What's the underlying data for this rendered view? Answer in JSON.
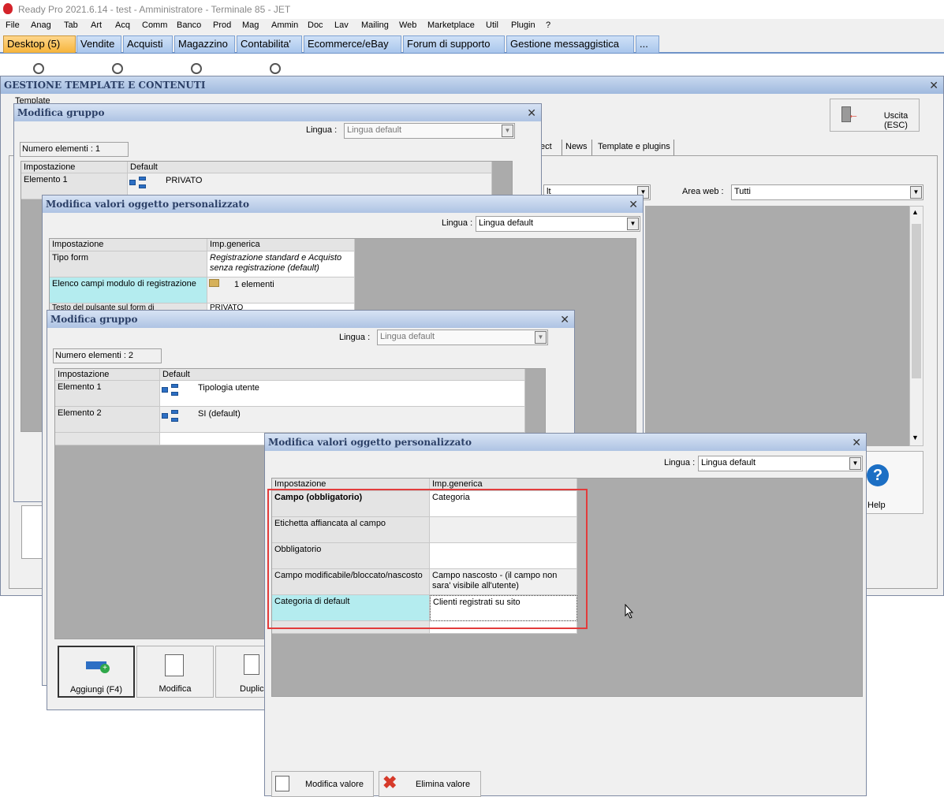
{
  "app": {
    "title": "Ready Pro 2021.6.14 - test - Amministratore - Terminale 85 - JET"
  },
  "menu": [
    "File",
    "Anag",
    "Tab",
    "Art",
    "Acq",
    "Comm",
    "Banco",
    "Prod",
    "Mag",
    "Ammin",
    "Doc",
    "Lav",
    "Mailing",
    "Web",
    "Marketplace",
    "Util",
    "Plugin",
    "?"
  ],
  "tabs": [
    "Desktop (5)",
    "Vendite",
    "Acquisti",
    "Magazzino",
    "Contabilita'",
    "Ecommerce/eBay",
    "Forum di supporto",
    "Gestione messaggistica",
    "..."
  ],
  "main_window": {
    "title": "GESTIONE TEMPLATE E CONTENUTI",
    "template_label": "Template",
    "exit_button": "Uscita (ESC)",
    "tabs": [
      "ect",
      "News",
      "Template e plugins"
    ],
    "area_web_label": "Area web :",
    "area_web_value": "Tutti",
    "left_combo_fragment": "lt",
    "help_label": "Help",
    "left_fragment": "A"
  },
  "win1": {
    "title": "Modifica gruppo",
    "lingua_label": "Lingua :",
    "lingua_value": "Lingua default",
    "count": "Numero elementi : 1",
    "headers": [
      "Impostazione",
      "Default"
    ],
    "rows": [
      {
        "key": "Elemento 1",
        "value": "PRIVATO"
      }
    ]
  },
  "win2": {
    "title": "Modifica valori oggetto personalizzato",
    "lingua_label": "Lingua :",
    "lingua_value": "Lingua default",
    "headers": [
      "Impostazione",
      "Imp.generica"
    ],
    "rows": [
      {
        "key": "Tipo form",
        "value": "Registrazione standard e Acquisto senza registrazione (default)"
      },
      {
        "key": "Elenco campi modulo di registrazione",
        "value": "1 elementi"
      },
      {
        "key": "Testo del pulsante sul form di",
        "value": "PRIVATO"
      }
    ]
  },
  "win3": {
    "title": "Modifica gruppo",
    "lingua_label": "Lingua :",
    "lingua_value": "Lingua default",
    "count": "Numero elementi : 2",
    "headers": [
      "Impostazione",
      "Default"
    ],
    "rows": [
      {
        "key": "Elemento 1",
        "value": "Tipologia utente"
      },
      {
        "key": "Elemento 2",
        "value": "SI (default)"
      }
    ],
    "buttons": {
      "add": "Aggiungi (F4)",
      "edit": "Modifica",
      "dup": "Duplica"
    }
  },
  "win4": {
    "title": "Modifica valori oggetto personalizzato",
    "lingua_label": "Lingua :",
    "lingua_value": "Lingua default",
    "headers": [
      "Impostazione",
      "Imp.generica"
    ],
    "rows": [
      {
        "key": "Campo (obbligatorio)",
        "value": "Categoria"
      },
      {
        "key": "Etichetta affiancata al campo",
        "value": ""
      },
      {
        "key": "Obbligatorio",
        "value": ""
      },
      {
        "key": "Campo modificabile/bloccato/nascosto",
        "value": "Campo nascosto - (il campo non sara' visibile all'utente)"
      },
      {
        "key": "Categoria di default",
        "value": "Clienti registrati su sito"
      }
    ],
    "buttons": {
      "edit_value": "Modifica valore",
      "delete_value": "Elimina valore"
    }
  },
  "colors": {
    "highlight": "#e23b3b",
    "selected_row": "#b4ecef",
    "tab_active": "#f6b43a"
  }
}
